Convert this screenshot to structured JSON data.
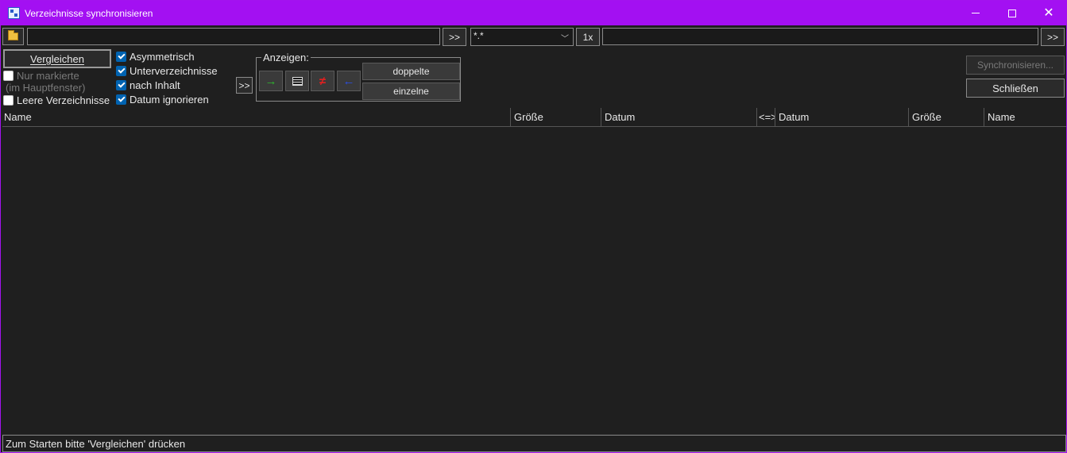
{
  "window": {
    "title": "Verzeichnisse synchronisieren",
    "accent_color": "#a310f2"
  },
  "toolbar": {
    "left_path_value": "",
    "left_arrow_label": ">>",
    "filter_value": "*.*",
    "once_label": "1x",
    "right_path_value": "",
    "right_arrow_label": ">>"
  },
  "options": {
    "compare_label": "Vergleichen",
    "only_marked_label": "Nur markierte",
    "only_marked_hint": "(im Hauptfenster)",
    "empty_dirs_label": "Leere Verzeichnisse",
    "asymmetric_label": "Asymmetrisch",
    "subdirs_label": "Unterverzeichnisse",
    "by_content_label": "nach Inhalt",
    "ignore_date_label": "Datum ignorieren",
    "expand_label": ">>"
  },
  "show_group": {
    "label": "Anzeigen:",
    "duplicates_label": "doppelte",
    "singles_label": "einzelne",
    "icons": {
      "copy_right": "→",
      "copy_left": "←",
      "not_equal": "≠"
    }
  },
  "actions": {
    "synchronize_label": "Synchronisieren...",
    "close_label": "Schließen"
  },
  "table": {
    "columns": [
      "Name",
      "Größe",
      "Datum",
      "<=>",
      "Datum",
      "Größe",
      "Name"
    ],
    "rows": []
  },
  "status": {
    "text": "Zum Starten bitte 'Vergleichen' drücken"
  }
}
